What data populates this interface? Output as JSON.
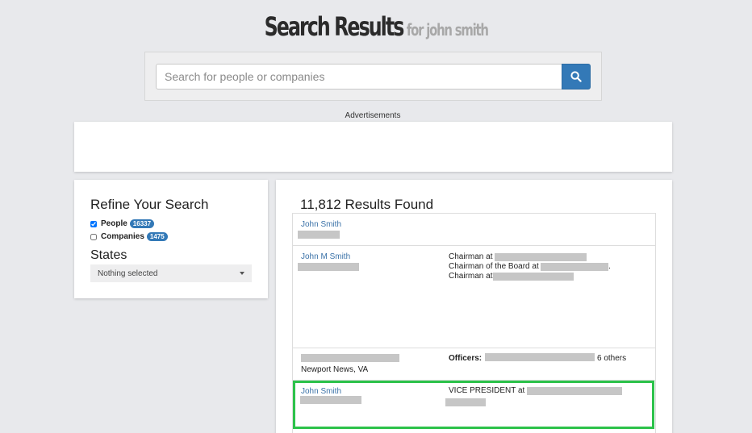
{
  "header": {
    "title": "Search Results",
    "for_text": "for john smith"
  },
  "search": {
    "placeholder": "Search for people or companies",
    "value": ""
  },
  "ads_label": "Advertisements",
  "refine": {
    "heading": "Refine Your Search",
    "filters": [
      {
        "label": "People",
        "count": "16337",
        "checked": true
      },
      {
        "label": "Companies",
        "count": "1475",
        "checked": false
      }
    ],
    "states_heading": "States",
    "states_select": "Nothing selected"
  },
  "results": {
    "heading": "11,812 Results Found",
    "rows": [
      {
        "name": "John Smith"
      },
      {
        "name": "John M Smith",
        "roles": [
          "Chairman at",
          "Chairman of the Board at",
          "Chairman at"
        ],
        "role_suffix_1": "."
      },
      {
        "location": "Newport News, VA",
        "officers_label": "Officers:",
        "officers_others": "6 others"
      },
      {
        "name": "John Smith",
        "role": "VICE PRESIDENT at"
      }
    ]
  },
  "colors": {
    "accent": "#3379b7",
    "highlight": "#2cc24a",
    "link": "#3b72a8"
  }
}
